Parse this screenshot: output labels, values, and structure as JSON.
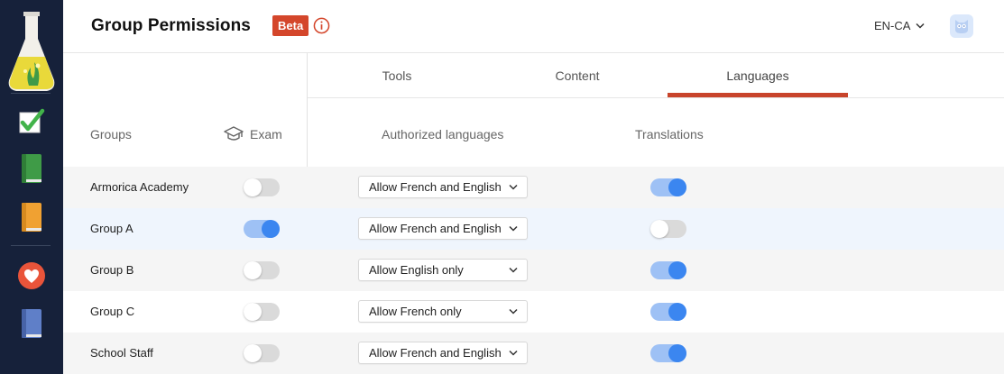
{
  "header": {
    "title": "Group Permissions",
    "beta_label": "Beta",
    "language_selector": "EN-CA"
  },
  "tabs": [
    {
      "label": "Tools",
      "active": false
    },
    {
      "label": "Content",
      "active": false
    },
    {
      "label": "Languages",
      "active": true
    }
  ],
  "columns": {
    "groups": "Groups",
    "exam": "Exam",
    "authorized_languages": "Authorized languages",
    "translations": "Translations"
  },
  "rows": [
    {
      "group": "Armorica Academy",
      "exam_enabled": false,
      "authorized_languages": "Allow French and English",
      "translations_enabled": true
    },
    {
      "group": "Group A",
      "exam_enabled": true,
      "authorized_languages": "Allow French and English",
      "translations_enabled": false
    },
    {
      "group": "Group B",
      "exam_enabled": false,
      "authorized_languages": "Allow English only",
      "translations_enabled": true
    },
    {
      "group": "Group C",
      "exam_enabled": false,
      "authorized_languages": "Allow French only",
      "translations_enabled": true
    },
    {
      "group": "School Staff",
      "exam_enabled": false,
      "authorized_languages": "Allow French and English",
      "translations_enabled": true
    }
  ],
  "sidebar": {
    "items": [
      {
        "icon": "flask-logo-icon"
      },
      {
        "icon": "checkbox-check-icon"
      },
      {
        "icon": "green-book-icon"
      },
      {
        "icon": "orange-book-icon"
      },
      {
        "icon": "heart-icon"
      },
      {
        "icon": "blue-book-icon"
      }
    ]
  },
  "colors": {
    "sidebar_bg": "#16213a",
    "accent_red": "#d4462b",
    "toggle_on_track": "#9ec1f5",
    "toggle_on_knob": "#3b86f0",
    "row_alt_bg": "#f5f5f5",
    "row_highlight_bg": "#eff5fd"
  }
}
